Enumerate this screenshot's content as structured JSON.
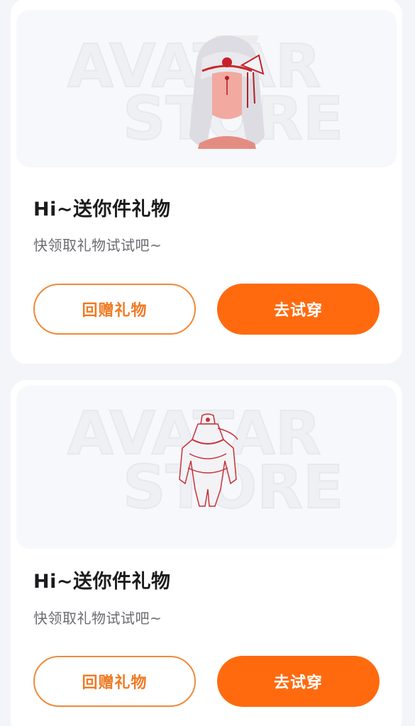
{
  "cards": [
    {
      "title": "Hi~送你件礼物",
      "subtitle": "快领取礼物试试吧~",
      "gift_button": "回赠礼物",
      "try_button": "去试穿",
      "watermark_line1": "AVATAR",
      "watermark_line2": "STORE",
      "item_icon": "hair-accessory-icon"
    },
    {
      "title": "Hi~送你件礼物",
      "subtitle": "快领取礼物试试吧~",
      "gift_button": "回赠礼物",
      "try_button": "去试穿",
      "watermark_line1": "AVATAR",
      "watermark_line2": "STORE",
      "item_icon": "outfit-icon"
    }
  ],
  "colors": {
    "accent": "#ff6a0f",
    "outline": "#f08a3a"
  }
}
